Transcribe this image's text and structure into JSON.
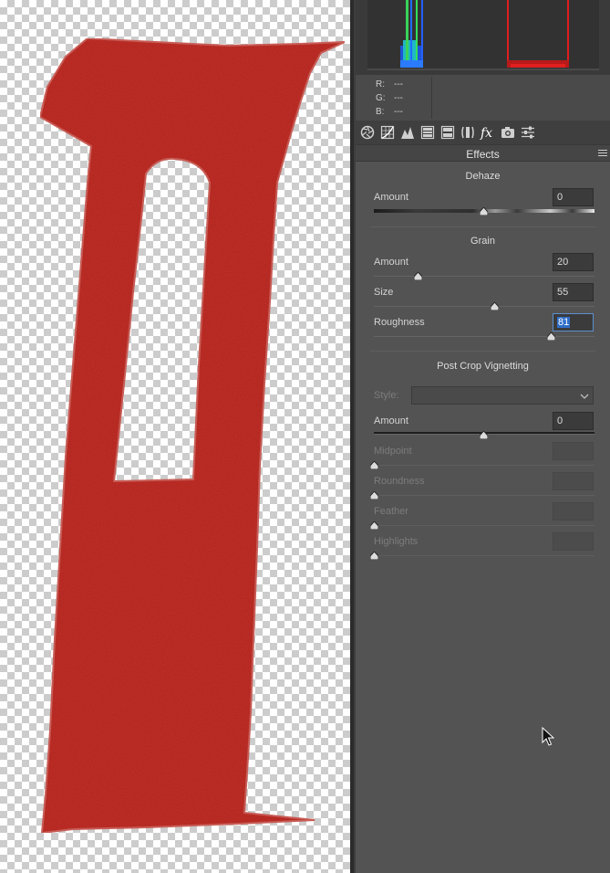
{
  "histogram": {
    "readout": [
      {
        "label": "R:",
        "value": "---"
      },
      {
        "label": "G:",
        "value": "---"
      },
      {
        "label": "B:",
        "value": "---"
      }
    ]
  },
  "tabs": [
    {
      "icon": "aperture-icon",
      "active": false
    },
    {
      "icon": "tone-curve-icon",
      "active": false
    },
    {
      "icon": "detail-icon",
      "active": false
    },
    {
      "icon": "hsl-icon",
      "active": false
    },
    {
      "icon": "split-toning-icon",
      "active": false
    },
    {
      "icon": "lens-corrections-icon",
      "active": false
    },
    {
      "icon": "fx-icon",
      "active": true
    },
    {
      "icon": "camera-calibration-icon",
      "active": false
    },
    {
      "icon": "presets-sliders-icon",
      "active": false
    }
  ],
  "panel": {
    "title": "Effects"
  },
  "dehaze": {
    "title": "Dehaze",
    "amount_label": "Amount",
    "amount_value": "0",
    "amount_fraction": 0.5
  },
  "grain": {
    "title": "Grain",
    "amount_label": "Amount",
    "amount_value": "20",
    "amount_fraction": 0.2,
    "size_label": "Size",
    "size_value": "55",
    "size_fraction": 0.55,
    "roughness_label": "Roughness",
    "roughness_value": "81",
    "roughness_fraction": 0.81
  },
  "vignette": {
    "title": "Post Crop Vignetting",
    "style_label": "Style:",
    "style_value": "",
    "amount_label": "Amount",
    "amount_value": "0",
    "amount_fraction": 0.5,
    "midpoint_label": "Midpoint",
    "midpoint_value": "",
    "midpoint_fraction": 0.0,
    "roundness_label": "Roundness",
    "roundness_value": "",
    "roundness_fraction": 0.0,
    "feather_label": "Feather",
    "feather_value": "",
    "feather_fraction": 0.0,
    "highlights_label": "Highlights",
    "highlights_value": "",
    "highlights_fraction": 0.0
  },
  "colors": {
    "shape_red": "#c8312c",
    "accent_blue": "#2f6ec9",
    "panel_bg": "#535353"
  }
}
